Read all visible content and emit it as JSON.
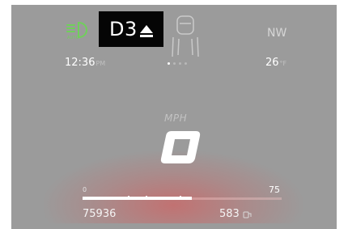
{
  "gauge_panel": {
    "headlight_status": {
      "icon": "auto-headlight-icon",
      "label": "AUTO",
      "color": "#6fd05a"
    },
    "gear": {
      "value": "D3",
      "icon": "arrow-up-icon"
    },
    "driver_assist_icon": "car-lanes-icon",
    "heading": "NW",
    "clock": {
      "time": "12:36",
      "period": "PM"
    },
    "page_indicator": {
      "total": 4,
      "active_index": 0
    },
    "outside_temp": {
      "value": "26",
      "unit": "°F"
    },
    "speed": {
      "unit": "MPH",
      "value": "0"
    },
    "power_meter": {
      "min_label": "0",
      "max_label": "75",
      "fill_fraction": 0.55,
      "accent_color": "#e46a6a"
    },
    "odometer": "75936",
    "range": {
      "value": "583",
      "icon": "fuel-range-icon"
    }
  }
}
